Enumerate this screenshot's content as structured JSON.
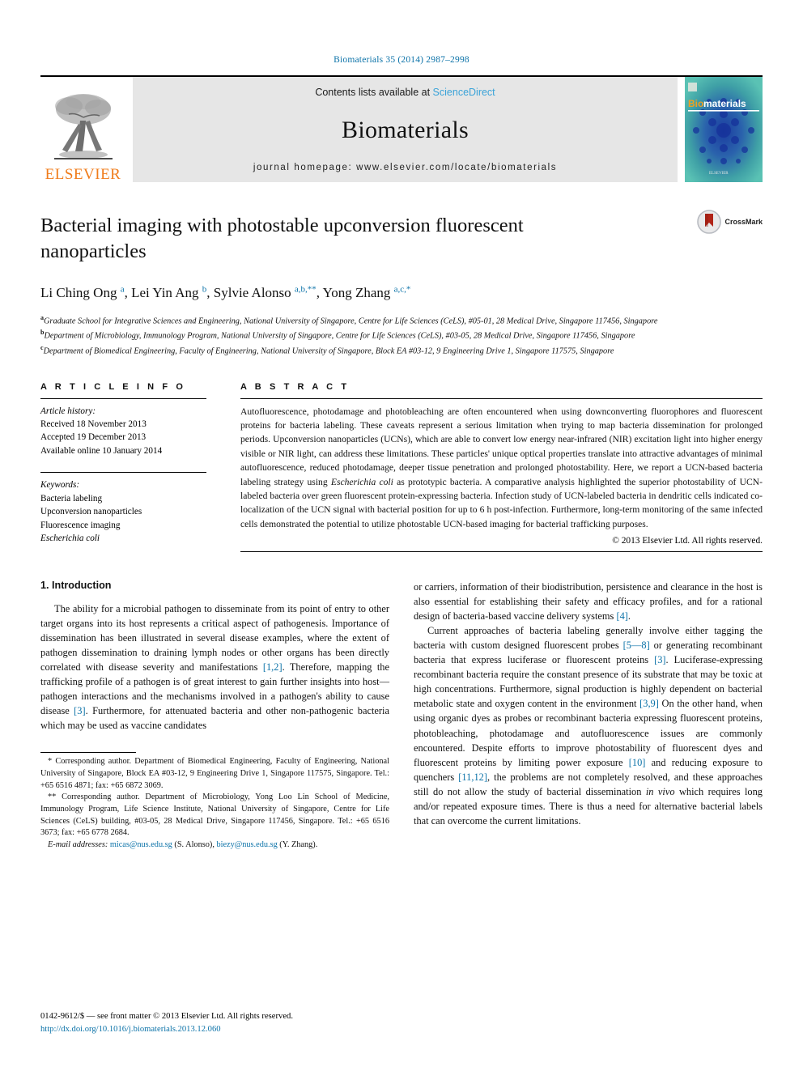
{
  "running_head": "Biomaterials 35 (2014) 2987–2998",
  "masthead": {
    "publisher_name": "ELSEVIER",
    "contents_prefix": "Contents lists available at",
    "sciencedirect": "ScienceDirect",
    "journal_title": "Biomaterials",
    "homepage": "journal homepage: www.elsevier.com/locate/biomaterials",
    "cover_title_a": "Bio",
    "cover_title_b": "materials",
    "colors": {
      "link_blue": "#3aa3d8",
      "elsevier_orange": "#f07c1b",
      "banner_grey": "#e6e6e6",
      "cover_teal": "#3fa8a0",
      "cover_blue": "#1c3fa0"
    }
  },
  "article": {
    "title": "Bacterial imaging with photostable upconversion fluorescent nanoparticles",
    "crossmark_label": "CrossMark",
    "authors_html": "Li Ching Ong <sup>a</sup>, Lei Yin Ang <sup>b</sup>, Sylvie Alonso <sup>a,b,**</sup>, Yong Zhang <sup>a,c,*</sup>",
    "affiliations": [
      {
        "marker": "a",
        "text": "Graduate School for Integrative Sciences and Engineering, National University of Singapore, Centre for Life Sciences (CeLS), #05-01, 28 Medical Drive, Singapore 117456, Singapore"
      },
      {
        "marker": "b",
        "text": "Department of Microbiology, Immunology Program, National University of Singapore, Centre for Life Sciences (CeLS), #03-05, 28 Medical Drive, Singapore 117456, Singapore"
      },
      {
        "marker": "c",
        "text": "Department of Biomedical Engineering, Faculty of Engineering, National University of Singapore, Block EA #03-12, 9 Engineering Drive 1, Singapore 117575, Singapore"
      }
    ]
  },
  "article_info": {
    "heading": "A R T I C L E   I N F O",
    "history_label": "Article history:",
    "history": [
      "Received 18 November 2013",
      "Accepted 19 December 2013",
      "Available online 10 January 2014"
    ],
    "keywords_label": "Keywords:",
    "keywords": [
      "Bacteria labeling",
      "Upconversion nanoparticles",
      "Fluorescence imaging",
      "Escherichia coli"
    ],
    "keyword_italic_index": 3
  },
  "abstract": {
    "heading": "A B S T R A C T",
    "paragraph_html": "Autofluorescence, photodamage and photobleaching are often encountered when using downconverting fluorophores and fluorescent proteins for bacteria labeling. These caveats represent a serious limitation when trying to map bacteria dissemination for prolonged periods. Upconversion nanoparticles (UCNs), which are able to convert low energy near-infrared (NIR) excitation light into higher energy visible or NIR light, can address these limitations. These particles' unique optical properties translate into attractive advantages of minimal autofluorescence, reduced photodamage, deeper tissue penetration and prolonged photostability. Here, we report a UCN-based bacteria labeling strategy using <span class=\"ital\">Escherichia coli</span> as prototypic bacteria. A comparative analysis highlighted the superior photostability of UCN-labeled bacteria over green fluorescent protein-expressing bacteria. Infection study of UCN-labeled bacteria in dendritic cells indicated co-localization of the UCN signal with bacterial position for up to 6 h post-infection. Furthermore, long-term monitoring of the same infected cells demonstrated the potential to utilize photostable UCN-based imaging for bacterial trafficking purposes.",
    "copyright": "© 2013 Elsevier Ltd. All rights reserved."
  },
  "body": {
    "section_number_title": "1.  Introduction",
    "left_paragraph_html": "The ability for a microbial pathogen to disseminate from its point of entry to other target organs into its host represents a critical aspect of pathogenesis. Importance of dissemination has been illustrated in several disease examples, where the extent of pathogen dissemination to draining lymph nodes or other organs has been directly correlated with disease severity and manifestations <a class=\"cite\" href=\"#\">[1,2]</a>. Therefore, mapping the trafficking profile of a pathogen is of great interest to gain further insights into host—pathogen interactions and the mechanisms involved in a pathogen's ability to cause disease <a class=\"cite\" href=\"#\">[3]</a>. Furthermore, for attenuated bacteria and other non-pathogenic bacteria which may be used as vaccine candidates",
    "right_paragraph_1_html": "or carriers, information of their biodistribution, persistence and clearance in the host is also essential for establishing their safety and efficacy profiles, and for a rational design of bacteria-based vaccine delivery systems <a class=\"cite\" href=\"#\">[4]</a>.",
    "right_paragraph_2_html": "Current approaches of bacteria labeling generally involve either tagging the bacteria with custom designed fluorescent probes <a class=\"cite\" href=\"#\">[5—8]</a> or generating recombinant bacteria that express luciferase or fluorescent proteins <a class=\"cite\" href=\"#\">[3]</a>. Luciferase-expressing recombinant bacteria require the constant presence of its substrate that may be toxic at high concentrations. Furthermore, signal production is highly dependent on bacterial metabolic state and oxygen content in the environment <a class=\"cite\" href=\"#\">[3,9]</a> On the other hand, when using organic dyes as probes or recombinant bacteria expressing fluorescent proteins, photobleaching, photodamage and autofluorescence issues are commonly encountered. Despite efforts to improve photostability of fluorescent dyes and fluorescent proteins by limiting power exposure <a class=\"cite\" href=\"#\">[10]</a> and reducing exposure to quenchers <a class=\"cite\" href=\"#\">[11,12]</a>, the problems are not completely resolved, and these approaches still do not allow the study of bacterial dissemination <span class=\"ital\">in vivo</span> which requires long and/or repeated exposure times. There is thus a need for alternative bacterial labels that can overcome the current limitations."
  },
  "footnotes": {
    "corresponding_1_html": "* Corresponding author. Department of Biomedical Engineering, Faculty of Engineering, National University of Singapore, Block EA #03-12, 9 Engineering Drive 1, Singapore 117575, Singapore. Tel.: +65 6516 4871; fax: +65 6872 3069.",
    "corresponding_2_html": "** Corresponding author. Department of Microbiology, Yong Loo Lin School of Medicine, Immunology Program, Life Science Institute, National University of Singapore, Centre for Life Sciences (CeLS) building, #03-05, 28 Medical Drive, Singapore 117456, Singapore. Tel.: +65 6516 3673; fax: +65 6778 2684.",
    "email_html": "<span class=\"ital\">E-mail addresses:</span> <a href=\"#\">micas@nus.edu.sg</a> (S. Alonso), <a href=\"#\">biezy@nus.edu.sg</a> (Y. Zhang)."
  },
  "bottom": {
    "issn_line": "0142-9612/$ — see front matter © 2013 Elsevier Ltd. All rights reserved.",
    "doi": "http://dx.doi.org/10.1016/j.biomaterials.2013.12.060"
  }
}
